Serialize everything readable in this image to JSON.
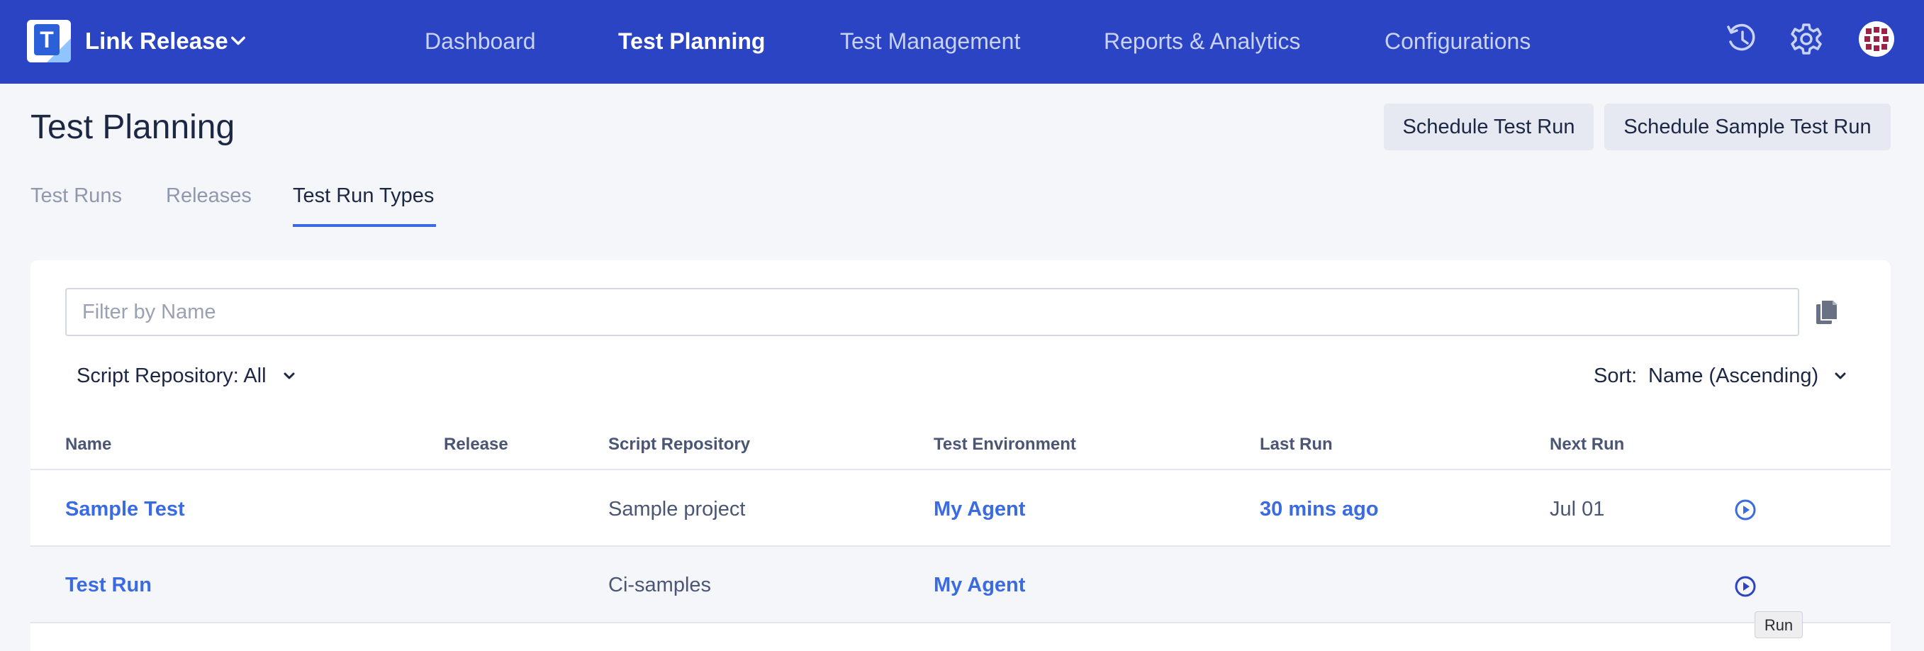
{
  "app": {
    "logo_letter": "T",
    "project_name": "Link Release"
  },
  "nav": {
    "items": [
      {
        "label": "Dashboard"
      },
      {
        "label": "Test Planning"
      },
      {
        "label": "Test Management"
      },
      {
        "label": "Reports & Analytics"
      },
      {
        "label": "Configurations"
      }
    ],
    "active_index": 1,
    "icons": [
      "history-icon",
      "gear-icon",
      "avatar"
    ]
  },
  "page": {
    "title": "Test Planning",
    "buttons": {
      "schedule": "Schedule Test Run",
      "schedule_sample": "Schedule Sample Test Run"
    }
  },
  "tabs": [
    {
      "label": "Test Runs"
    },
    {
      "label": "Releases"
    },
    {
      "label": "Test Run Types"
    }
  ],
  "tabs_active_index": 2,
  "filter": {
    "placeholder": "Filter by Name",
    "value": ""
  },
  "repo_filter": {
    "label": "Script Repository: All"
  },
  "sort": {
    "label": "Sort:",
    "value": "Name (Ascending)"
  },
  "table": {
    "columns": [
      "Name",
      "Release",
      "Script Repository",
      "Test Environment",
      "Last Run",
      "Next Run"
    ],
    "rows": [
      {
        "name": "Sample Test",
        "release": "",
        "script_repository": "Sample project",
        "test_environment": "My Agent",
        "last_run": "30 mins ago",
        "next_run": "Jul 01"
      },
      {
        "name": "Test Run",
        "release": "",
        "script_repository": "Ci-samples",
        "test_environment": "My Agent",
        "last_run": "",
        "next_run": ""
      }
    ]
  },
  "tooltip": "Run",
  "colors": {
    "brand": "#2b44c4",
    "accent": "#3b6be3",
    "background": "#f5f6f9"
  }
}
